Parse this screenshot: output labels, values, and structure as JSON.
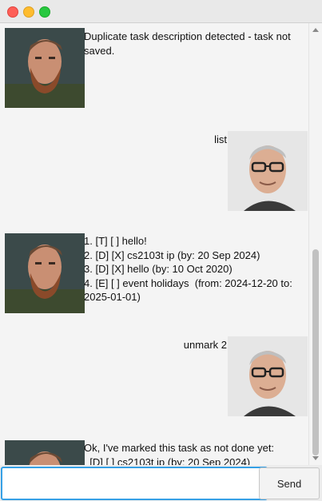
{
  "chat": {
    "messages": [
      {
        "sender": "bot",
        "text": "Duplicate task description detected - task not\nsaved."
      },
      {
        "sender": "user",
        "text": "list"
      },
      {
        "sender": "bot",
        "text": "1. [T] [ ] hello!\n2. [D] [X] cs2103t ip (by: 20 Sep 2024)\n3. [D] [X] hello (by: 10 Oct 2020)\n4. [E] [ ] event holidays  (from: 2024-12-20 to:\n2025-01-01)"
      },
      {
        "sender": "user",
        "text": "unmark 2"
      },
      {
        "sender": "bot",
        "text": "Ok, I've marked this task as not done yet:\n  [D] [ ] cs2103t ip (by: 20 Sep 2024)"
      }
    ]
  },
  "input": {
    "value": "",
    "placeholder": ""
  },
  "send_label": "Send"
}
